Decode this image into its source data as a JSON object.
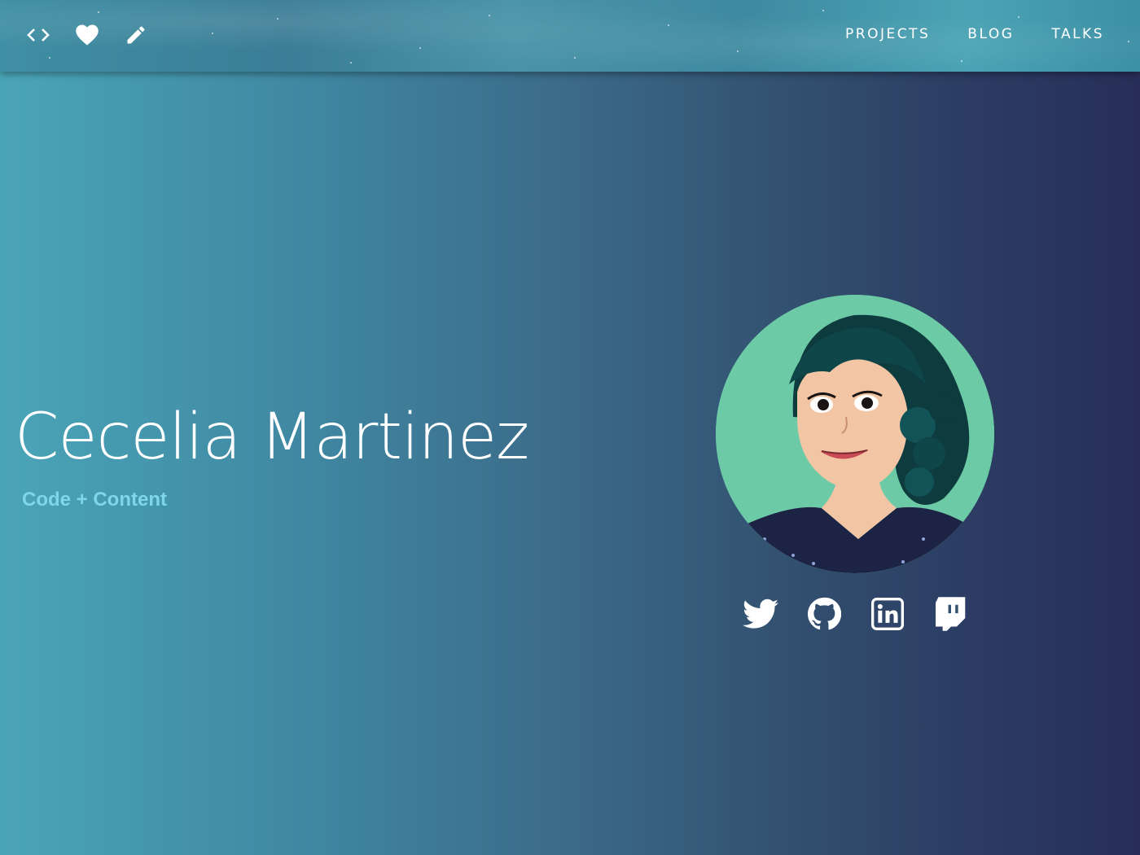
{
  "nav": {
    "icons": [
      "code-icon",
      "heart-icon",
      "pencil-icon"
    ],
    "links": [
      "PROJECTS",
      "BLOG",
      "TALKS"
    ]
  },
  "hero": {
    "name": "Cecelia Martinez",
    "tagline": "Code + Content"
  },
  "socials": [
    "twitter-icon",
    "github-icon",
    "linkedin-icon",
    "twitch-icon"
  ],
  "colors": {
    "tagline": "#7fd6ea",
    "avatar_bg": "#6ccba6",
    "gradient_left": "#4aa5b7",
    "gradient_right": "#282e58"
  }
}
